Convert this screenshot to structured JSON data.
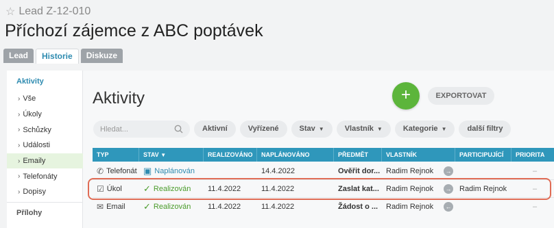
{
  "header": {
    "lead_id": "Lead Z-12-010",
    "title": "Příchozí zájemce z ABC poptávek"
  },
  "tabs": [
    "Lead",
    "Historie",
    "Diskuze"
  ],
  "sidebar": {
    "heading": "Aktivity",
    "items": [
      "Vše",
      "Úkoly",
      "Schůzky",
      "Události",
      "Emaily",
      "Telefonáty",
      "Dopisy"
    ],
    "section2": "Přílohy"
  },
  "main": {
    "title": "Aktivity",
    "add_label": "+",
    "export_label": "EXPORTOVAT",
    "search_placeholder": "Hledat...",
    "filters": [
      "Aktivní",
      "Vyřízené",
      "Stav",
      "Vlastník",
      "Kategorie",
      "další filtry"
    ]
  },
  "table": {
    "columns": [
      "TYP",
      "STAV",
      "REALIZOVÁNO",
      "NAPLÁNOVÁNO",
      "PŘEDMĚT",
      "VLASTNÍK",
      "PARTICIPUJÍCÍ",
      "PRIORITA"
    ],
    "rows": [
      {
        "type": "Telefonát",
        "status": "Naplánován",
        "realized": "",
        "planned": "14.4.2022",
        "subject": "Ověřit dor...",
        "owner": "Radim Rejnok",
        "participant": "",
        "priority": "–"
      },
      {
        "type": "Úkol",
        "status": "Realizován",
        "realized": "11.4.2022",
        "planned": "11.4.2022",
        "subject": "Zaslat kat...",
        "owner": "Radim Rejnok",
        "participant": "Radim Rejnok",
        "priority": "–"
      },
      {
        "type": "Email",
        "status": "Realizován",
        "realized": "11.4.2022",
        "planned": "11.4.2022",
        "subject": "Žádost o ...",
        "owner": "Radim Rejnok",
        "participant": "",
        "priority": "–"
      }
    ]
  },
  "colors": {
    "accent_blue": "#2f97bb",
    "green": "#5cb53b",
    "highlight": "#e06c55"
  }
}
